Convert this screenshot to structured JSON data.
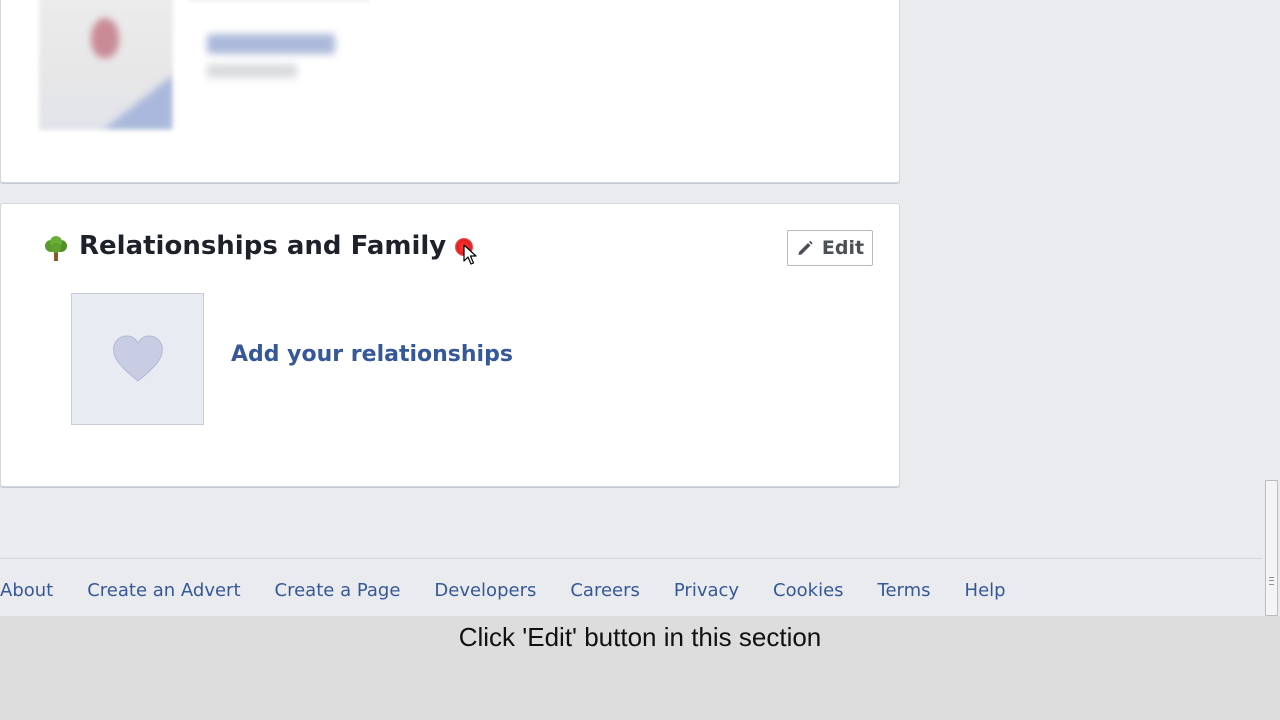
{
  "section": {
    "title": "Relationships and Family",
    "edit_label": "Edit",
    "add_link": "Add your relationships",
    "icon": "tree-icon"
  },
  "footer": {
    "links": [
      "About",
      "Create an Advert",
      "Create a Page",
      "Developers",
      "Careers",
      "Privacy",
      "Cookies",
      "Terms",
      "Help"
    ]
  },
  "caption": {
    "text": "Click 'Edit' button in this section"
  },
  "colors": {
    "link": "#365899",
    "page_bg": "#e9ebee",
    "marker": "#e41d1d"
  }
}
